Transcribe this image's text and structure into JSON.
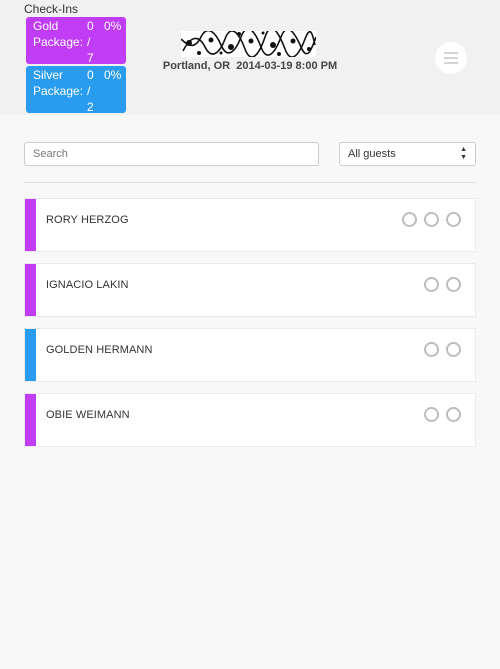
{
  "header": {
    "checkins_title": "Check-Ins",
    "packages": [
      {
        "name": "Gold Package:",
        "checked": "0",
        "separator": "/",
        "total": "7",
        "percent": "0%",
        "color": "#c03cf5"
      },
      {
        "name": "Silver Package:",
        "checked": "0",
        "separator": "/",
        "total": "2",
        "percent": "0%",
        "color": "#2a9cf0"
      }
    ],
    "event_location": "Portland, OR",
    "event_datetime": "2014-03-19 8:00 PM",
    "menu_icon": "hamburger-menu-icon"
  },
  "filters": {
    "search_placeholder": "Search",
    "guest_filter_selected": "All guests"
  },
  "guests": [
    {
      "name": "RORY HERZOG",
      "package": "Gold",
      "color": "#c03cf5",
      "checkin_slots": 3
    },
    {
      "name": "IGNACIO LAKIN",
      "package": "Gold",
      "color": "#c03cf5",
      "checkin_slots": 2
    },
    {
      "name": "GOLDEN HERMANN",
      "package": "Silver",
      "color": "#2a9cf0",
      "checkin_slots": 2
    },
    {
      "name": "OBIE WEIMANN",
      "package": "Gold",
      "color": "#c03cf5",
      "checkin_slots": 2
    }
  ]
}
